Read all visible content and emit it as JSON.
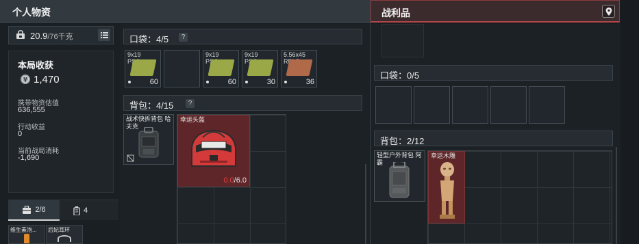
{
  "left_panel": {
    "title": "个人物资",
    "weight": {
      "current": "20.9",
      "max": "/76千克"
    },
    "stats": {
      "title": "本局收获",
      "coin_value": "1,470",
      "carried_label": "携带物资估值",
      "carried_value": "636,555",
      "income_label": "行动收益",
      "income_value": "0",
      "cost_label": "当前战局消耗",
      "cost_value": "-1,690"
    },
    "tabs": [
      {
        "label": "2/6",
        "icon": "backpack-icon"
      },
      {
        "label": "4",
        "icon": "canister-icon"
      }
    ],
    "mini_items": [
      "维生素泡...",
      "后妃耳环"
    ],
    "pocket": {
      "label": "口袋：4/5",
      "help": "?",
      "items": [
        {
          "caliber": "9x19",
          "sub": "PSO",
          "count": "60",
          "color": "#9aa848"
        },
        {
          "caliber": "",
          "sub": "",
          "count": "",
          "color": ""
        },
        {
          "caliber": "9x19",
          "sub": "PSO",
          "count": "60",
          "color": "#9aa848"
        },
        {
          "caliber": "9x19",
          "sub": "PSO",
          "count": "30",
          "color": "#9aa848"
        },
        {
          "caliber": "5.56x45",
          "sub": "RRLP",
          "count": "36",
          "color": "#b06a4a"
        }
      ]
    },
    "backpack": {
      "label": "背包：4/15",
      "help": "?",
      "bag_name": "战术快拆背包 哈夫克",
      "helmet_name": "幸运头盔",
      "durability_current": "0.0",
      "durability_max": "/6.0"
    }
  },
  "right_panel": {
    "title": "战利品",
    "pocket_label": "口袋：0/5",
    "backpack_label": "背包：2/12",
    "bag_name": "轻型户外背包 阿霸",
    "statue_name": "幸运木雕"
  },
  "colors": {
    "accent_red": "#b2474a",
    "durability_red": "#e04848",
    "helmet_bg": "#6a2a2c"
  }
}
